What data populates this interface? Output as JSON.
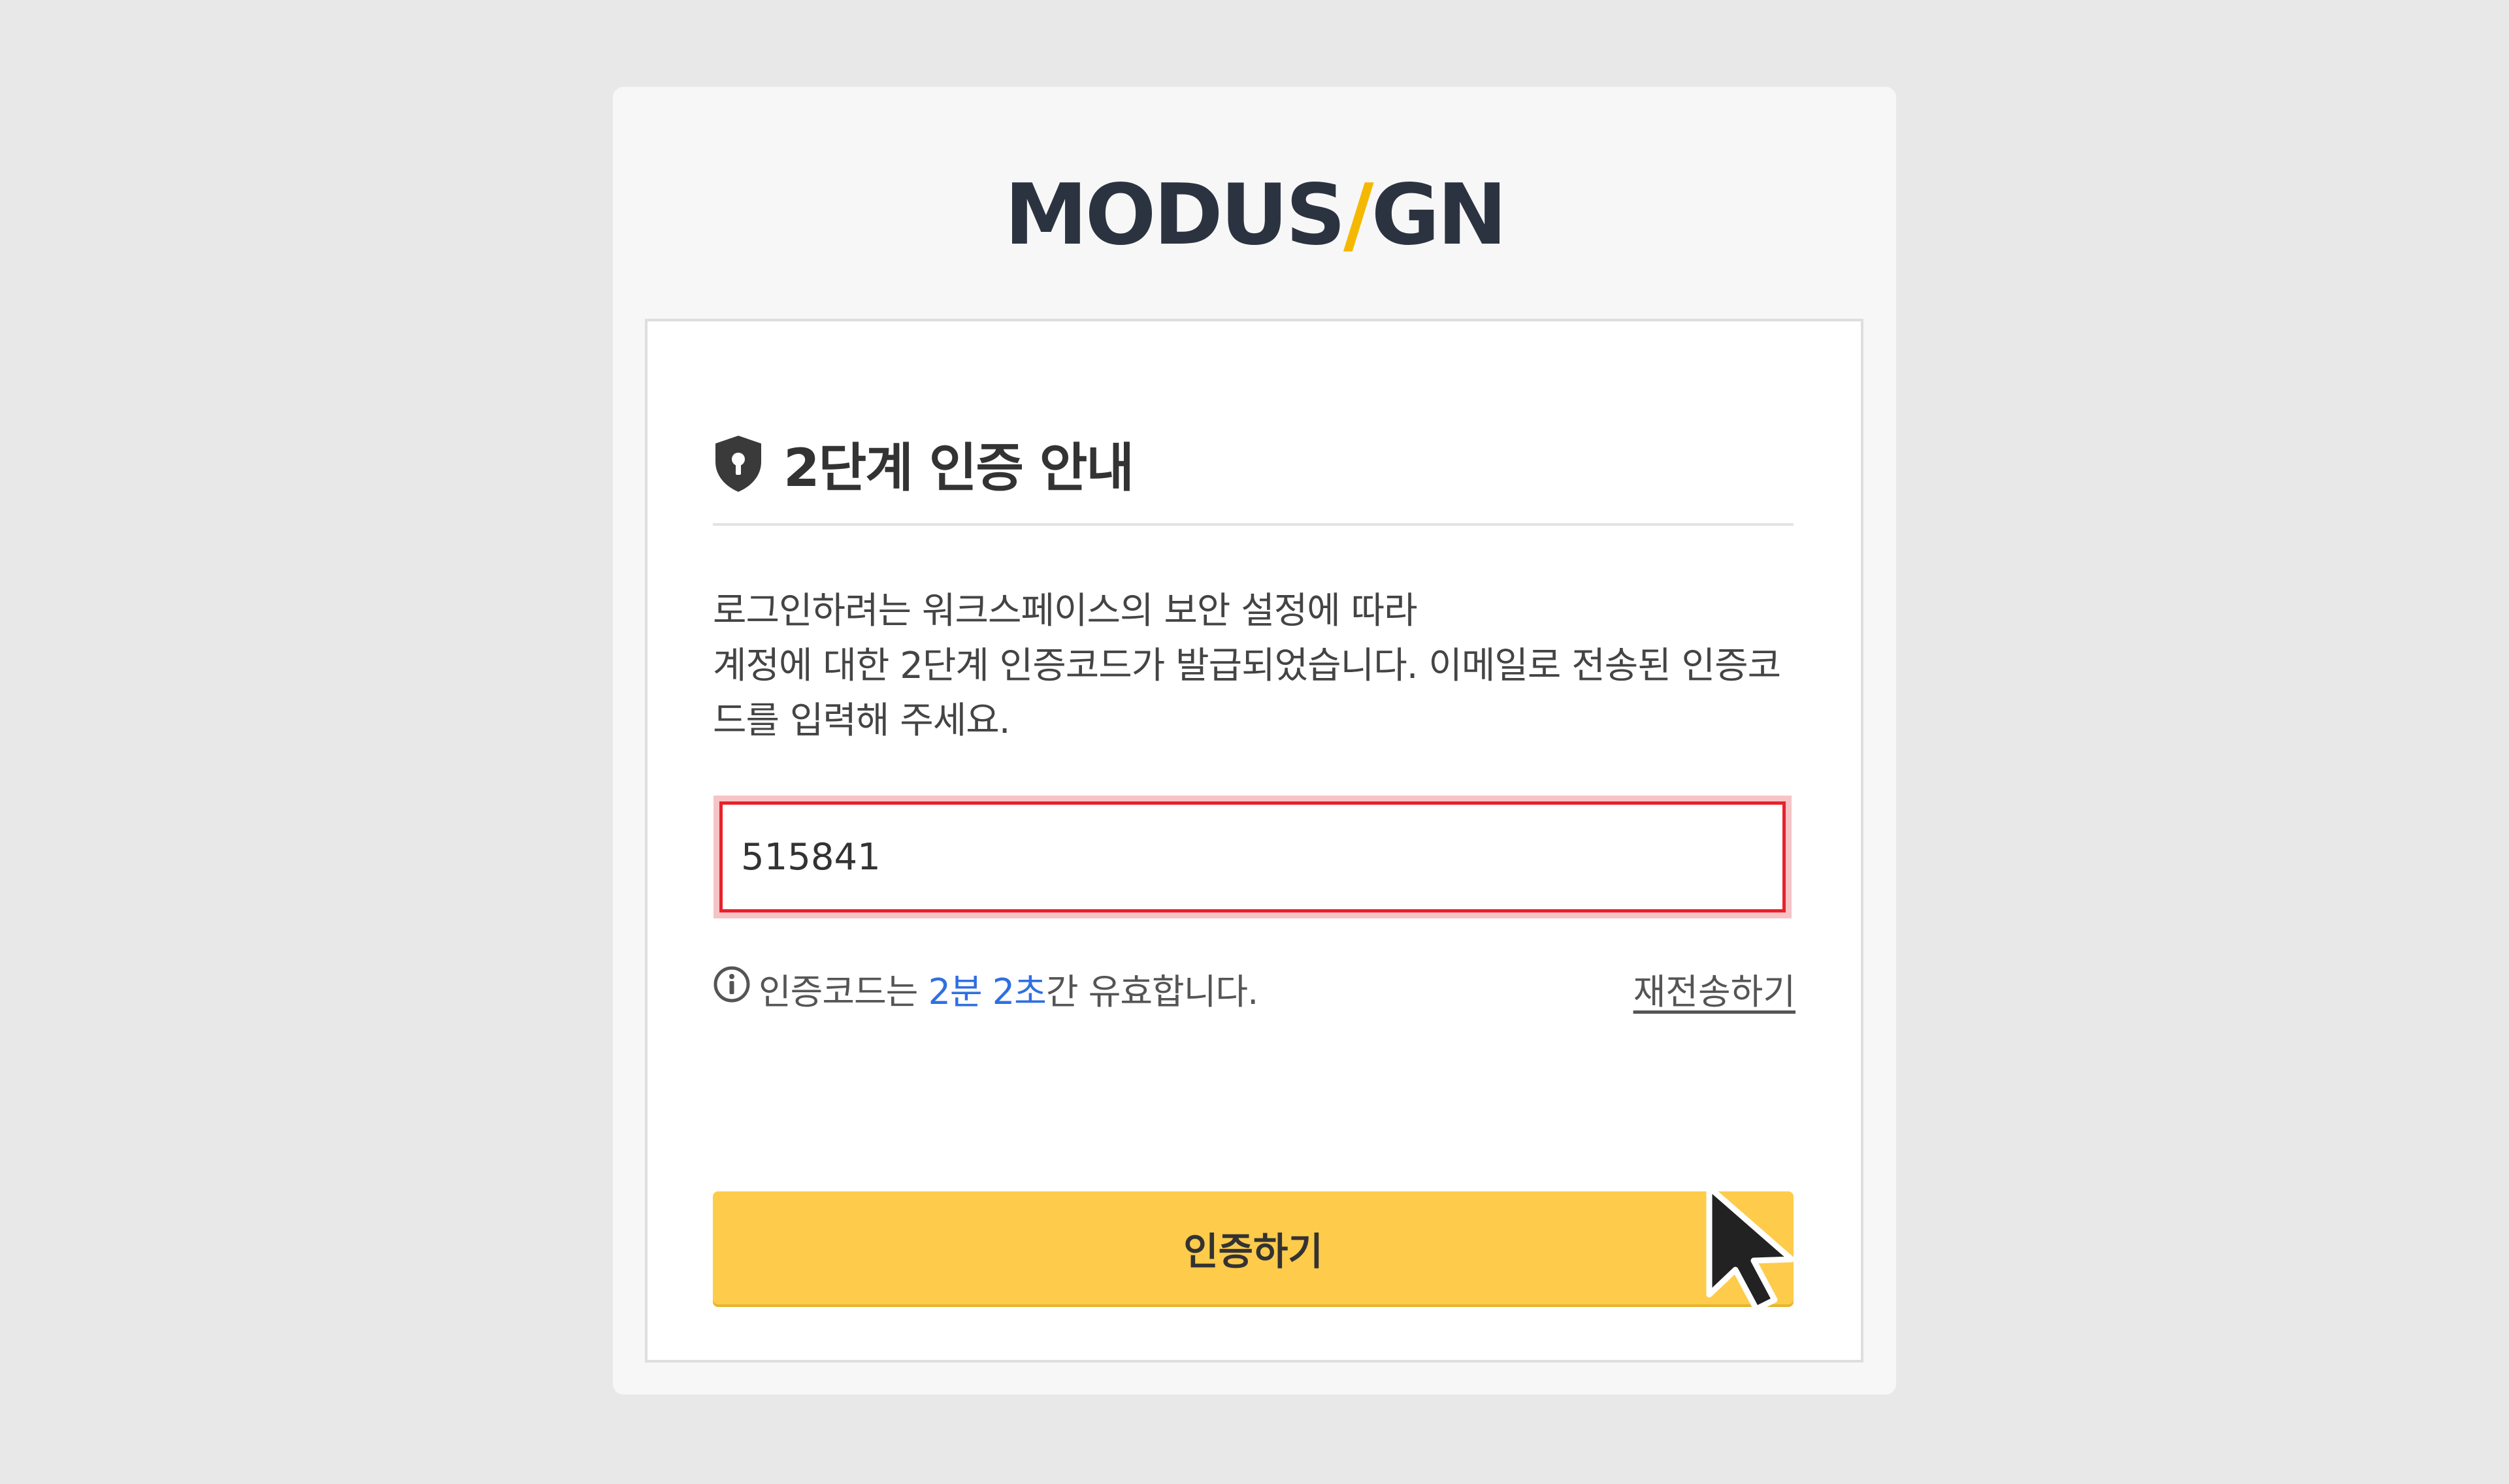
{
  "logo": {
    "part1": "MODUS",
    "slash": "/",
    "part2": "GN",
    "slash_color": "#f5b800"
  },
  "heading": {
    "icon": "shield-lock-icon",
    "title": "2단계 인증 안내"
  },
  "description": {
    "lines": [
      "로그인하려는 워크스페이스의 보안 설정에 따라",
      "계정에 대한 2단계 인증코드가 발급되었습니다. 이메일로 전송된 인증코",
      "드를 입력해 주세요."
    ]
  },
  "code_input": {
    "value": "515841",
    "border_color": "#e8212b"
  },
  "validity": {
    "icon": "info-circle-icon",
    "prefix": "인증코드는 ",
    "minutes": "2분",
    "space": " ",
    "seconds": "2초",
    "suffix": "간 유효합니다.",
    "highlight_color": "#2f6fe0"
  },
  "resend": {
    "label": "재전송하기"
  },
  "verify_button": {
    "label": "인증하기",
    "color": "#fecb4b"
  },
  "cursor": {
    "icon": "mouse-pointer-icon"
  }
}
